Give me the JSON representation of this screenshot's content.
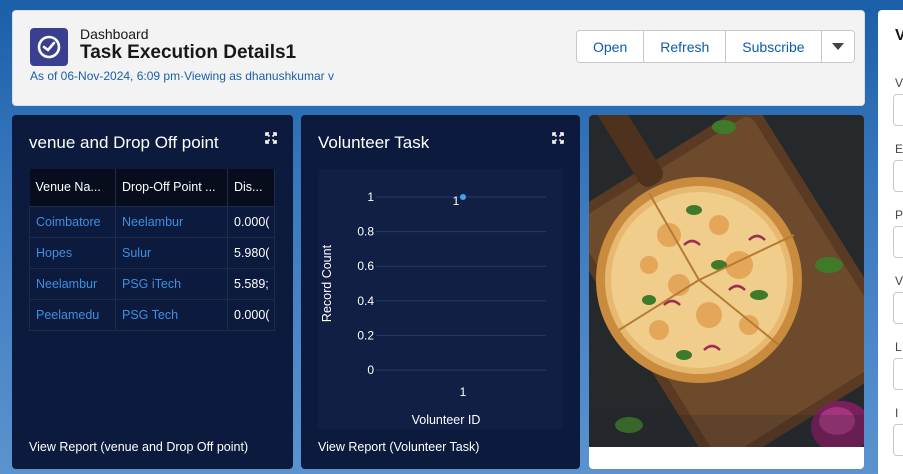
{
  "header": {
    "eyebrow": "Dashboard",
    "title": "Task Execution Details1",
    "meta": "As of 06-Nov-2024, 6:09 pm·Viewing as dhanushkumar v",
    "buttons": {
      "open": "Open",
      "refresh": "Refresh",
      "subscribe": "Subscribe"
    }
  },
  "venue_card": {
    "title": "venue and Drop Off point",
    "columns": [
      "Venue Na...",
      "Drop-Off Point ...",
      "Dis..."
    ],
    "rows": [
      [
        "Coimbatore",
        "Neelambur",
        "0.000("
      ],
      [
        "Hopes",
        "Sulur",
        "5.980("
      ],
      [
        "Neelambur",
        "PSG iTech",
        "5.589;"
      ],
      [
        "Peelamedu",
        "PSG Tech",
        "0.000("
      ]
    ],
    "footer": "View Report (venue and Drop Off point)"
  },
  "volunteer_card": {
    "title": "Volunteer Task",
    "footer": "View Report (Volunteer Task)"
  },
  "chart_data": {
    "type": "scatter",
    "x": [
      "1"
    ],
    "y": [
      1
    ],
    "data_labels": [
      "1"
    ],
    "y_ticks": [
      "1",
      "0.8",
      "0.6",
      "0.4",
      "0.2",
      "0"
    ],
    "ylim": [
      0,
      1
    ],
    "xlabel": "Volunteer ID",
    "ylabel": "Record Count",
    "grid": true,
    "point_color": "#4a9fe8"
  },
  "right_panel": {
    "title": "V",
    "labels": [
      "V",
      "E",
      "P",
      "V",
      "L",
      "I"
    ]
  },
  "icons": {
    "app": "dashboard-gauge-icon",
    "expand": "expand-icon",
    "caret": "chevron-down-icon"
  }
}
